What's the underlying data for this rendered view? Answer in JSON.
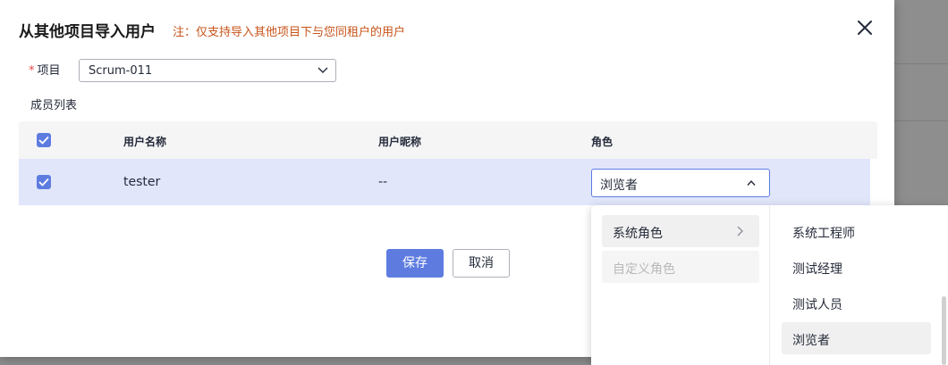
{
  "dialog": {
    "title": "从其他项目导入用户",
    "note": "注：仅支持导入其他项目下与您同租户的用户"
  },
  "project_field": {
    "required_mark": "*",
    "label": "项目",
    "value": "Scrum-011"
  },
  "member_list": {
    "title": "成员列表",
    "columns": [
      "用户名称",
      "用户昵称",
      "角色"
    ],
    "rows": [
      {
        "checked": true,
        "username": "tester",
        "nickname": "--",
        "role": "浏览者"
      }
    ]
  },
  "buttons": {
    "save": "保存",
    "cancel": "取消"
  },
  "role_dropdown": {
    "categories": [
      {
        "label": "系统角色",
        "active": true,
        "disabled": false
      },
      {
        "label": "自定义角色",
        "active": false,
        "disabled": true
      }
    ],
    "items": [
      {
        "label": "系统工程师",
        "selected": false
      },
      {
        "label": "测试经理",
        "selected": false
      },
      {
        "label": "测试人员",
        "selected": false
      },
      {
        "label": "浏览者",
        "selected": true
      }
    ]
  },
  "colors": {
    "accent": "#5e7ce0",
    "note": "#c7541a",
    "row_highlight": "#e1e6fb"
  }
}
